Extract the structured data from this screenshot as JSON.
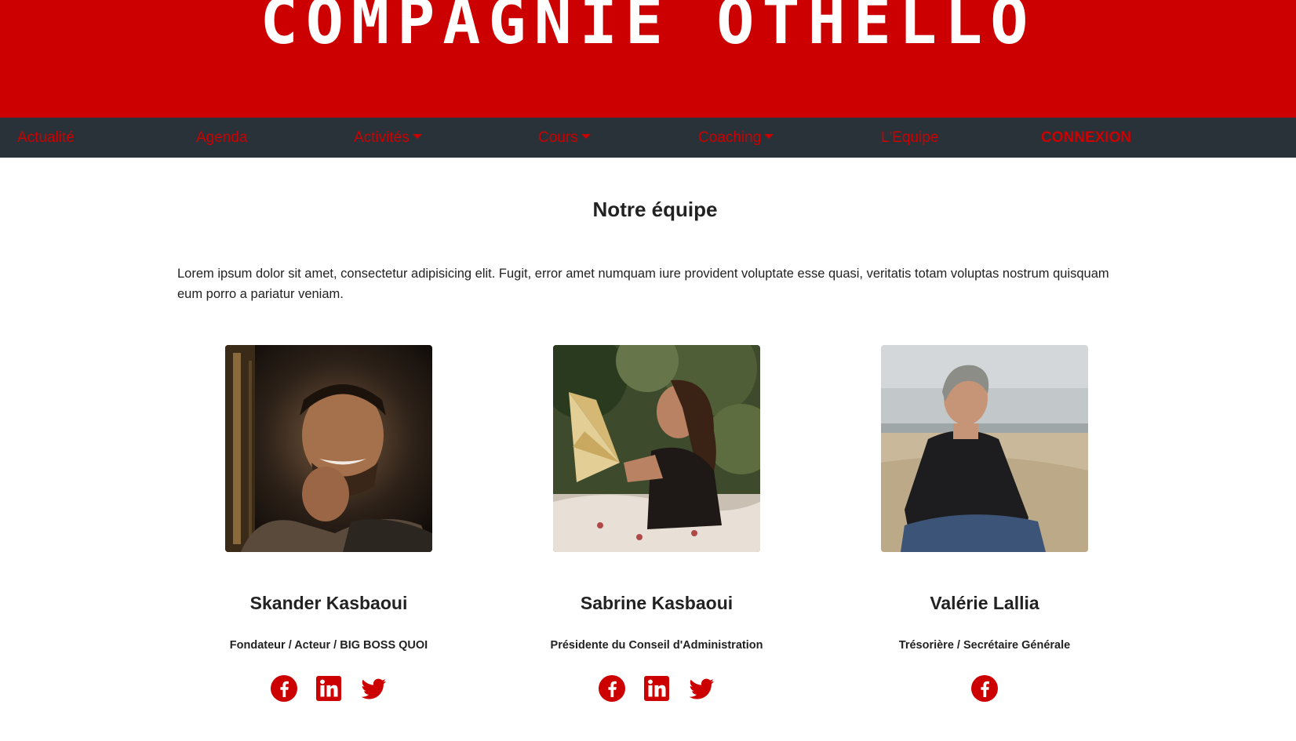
{
  "header": {
    "title": "COMPAGNIE OTHELLO"
  },
  "nav": {
    "items": [
      {
        "label": "Actualité",
        "dropdown": false
      },
      {
        "label": "Agenda",
        "dropdown": false
      },
      {
        "label": "Activités",
        "dropdown": true
      },
      {
        "label": "Cours",
        "dropdown": true
      },
      {
        "label": "Coaching",
        "dropdown": true
      },
      {
        "label": "L'Equipe",
        "dropdown": false
      },
      {
        "label": "CONNEXION",
        "dropdown": false
      }
    ]
  },
  "main": {
    "title": "Notre équipe",
    "intro": "Lorem ipsum dolor sit amet, consectetur adipisicing elit. Fugit, error amet numquam iure provident voluptate esse quasi, veritatis totam voluptas nostrum quisquam eum porro a pariatur veniam."
  },
  "team": [
    {
      "name": "Skander Kasbaoui",
      "role": "Fondateur / Acteur / BIG BOSS QUOI",
      "socials": [
        "facebook-icon",
        "linkedin-icon",
        "twitter-icon"
      ]
    },
    {
      "name": "Sabrine Kasbaoui",
      "role": "Présidente du Conseil d'Administration",
      "socials": [
        "facebook-icon",
        "linkedin-icon",
        "twitter-icon"
      ]
    },
    {
      "name": "Valérie Lallia",
      "role": "Trésorière / Secrétaire Générale",
      "socials": [
        "facebook-icon"
      ]
    }
  ],
  "colors": {
    "brand_red": "#cc0000",
    "nav_bg": "#283238",
    "text": "#222222"
  }
}
